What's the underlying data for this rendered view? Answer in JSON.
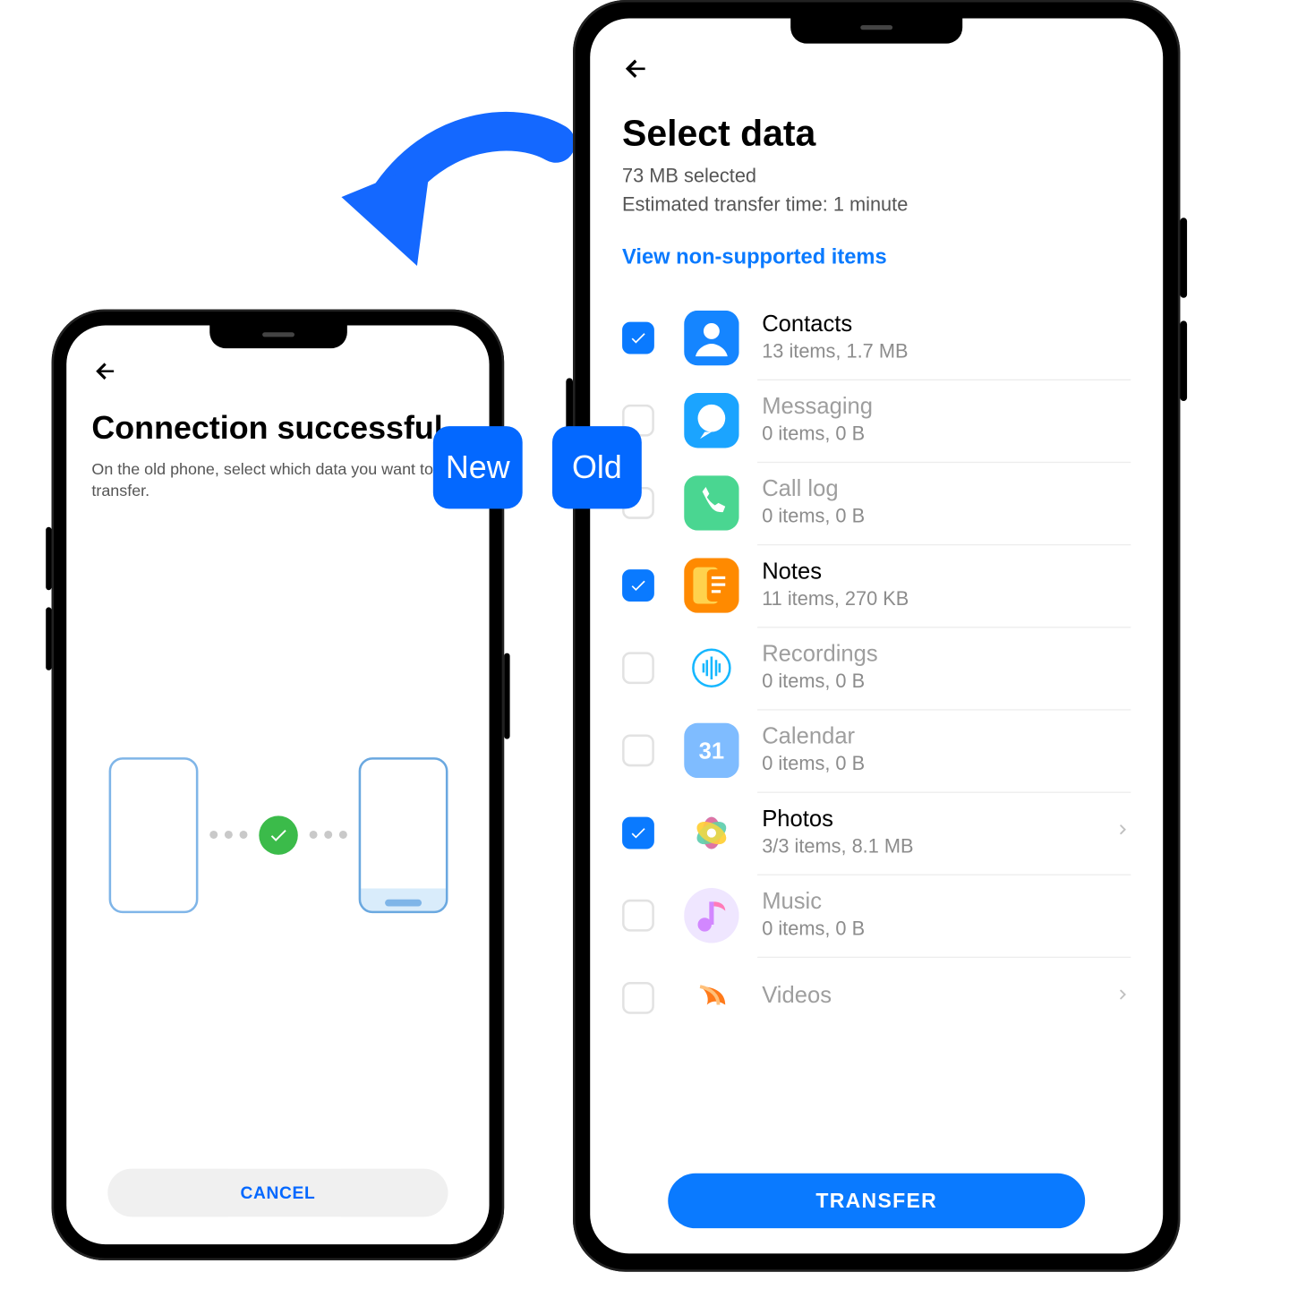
{
  "badges": {
    "new": "New",
    "old": "Old"
  },
  "left": {
    "title": "Connection successful",
    "subtitle": "On the old phone, select which data you want to transfer.",
    "cancel": "CANCEL"
  },
  "right": {
    "title": "Select data",
    "selected": "73 MB selected",
    "eta": "Estimated transfer time: 1 minute",
    "link": "View non-supported items",
    "transfer": "TRANSFER",
    "items": [
      {
        "icon": "contacts",
        "bg": "#1585ff",
        "title": "Contacts",
        "sub": "13 items, 1.7 MB",
        "checked": true,
        "chevron": false,
        "dim": false
      },
      {
        "icon": "messaging",
        "bg": "#1ba4ff",
        "title": "Messaging",
        "sub": "0 items, 0 B",
        "checked": false,
        "chevron": false,
        "dim": true
      },
      {
        "icon": "call",
        "bg": "#4ad691",
        "title": "Call log",
        "sub": "0 items, 0 B",
        "checked": false,
        "chevron": false,
        "dim": true
      },
      {
        "icon": "notes",
        "bg": "#ffb300",
        "title": "Notes",
        "sub": "11 items, 270 KB",
        "checked": true,
        "chevron": false,
        "dim": false
      },
      {
        "icon": "recordings",
        "bg": "#ffffff",
        "title": "Recordings",
        "sub": "0 items, 0 B",
        "checked": false,
        "chevron": false,
        "dim": true
      },
      {
        "icon": "calendar",
        "bg": "#7fbcff",
        "title": "Calendar",
        "sub": "0 items, 0 B",
        "checked": false,
        "chevron": false,
        "dim": true
      },
      {
        "icon": "photos",
        "bg": "#ffffff",
        "title": "Photos",
        "sub": "3/3 items, 8.1 MB",
        "checked": true,
        "chevron": true,
        "dim": false
      },
      {
        "icon": "music",
        "bg": "#f0eaff",
        "title": "Music",
        "sub": "0 items, 0 B",
        "checked": false,
        "chevron": false,
        "dim": true
      },
      {
        "icon": "videos",
        "bg": "#ffffff",
        "title": "Videos",
        "sub": "",
        "checked": false,
        "chevron": true,
        "dim": true
      }
    ]
  },
  "icons": {
    "calendar_day": "31"
  }
}
